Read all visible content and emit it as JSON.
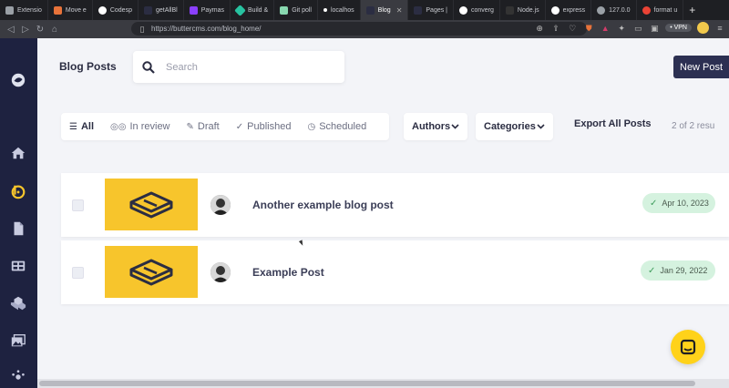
{
  "browser": {
    "tabs": [
      {
        "label": "Extensio",
        "color": "#9aa0a6"
      },
      {
        "label": "Move e",
        "color": "#e8733a"
      },
      {
        "label": "Codesp",
        "color": "#ffffff"
      },
      {
        "label": "getAllBl",
        "color": "#2b2d42"
      },
      {
        "label": "Paymas",
        "color": "#8a3ffc"
      },
      {
        "label": "Build &",
        "color": "#27c2a0"
      },
      {
        "label": "Git poll",
        "color": "#88d8b0"
      },
      {
        "label": "localhos",
        "color": "#ffffff"
      },
      {
        "label": "Blog",
        "color": "#2b2d42",
        "active": true,
        "close": "✕"
      },
      {
        "label": "Pages |",
        "color": "#2b2d42"
      },
      {
        "label": "converg",
        "color": "#ffffff"
      },
      {
        "label": "Node.js",
        "color": "#333333"
      },
      {
        "label": "express",
        "color": "#ffffff"
      },
      {
        "label": "127.0.0",
        "color": "#9aa0a6"
      },
      {
        "label": "format u",
        "color": "#ea4335"
      }
    ],
    "new_tab_symbol": "+",
    "url": "https://buttercms.com/blog_home/",
    "vpn_label": "• VPN"
  },
  "header": {
    "title": "Blog Posts",
    "search_placeholder": "Search",
    "new_post_label": "New Post"
  },
  "filters": {
    "tabs": [
      {
        "label": "All",
        "icon": "list-icon",
        "active": true
      },
      {
        "label": "In review",
        "icon": "glasses-icon"
      },
      {
        "label": "Draft",
        "icon": "pencil-icon"
      },
      {
        "label": "Published",
        "icon": "check-icon"
      },
      {
        "label": "Scheduled",
        "icon": "clock-icon"
      }
    ],
    "authors_label": "Authors",
    "categories_label": "Categories",
    "export_label": "Export All Posts",
    "count_text": "2 of 2 resu"
  },
  "posts": [
    {
      "title": "Another example blog post",
      "date": "Apr 10, 2023",
      "status": "published"
    },
    {
      "title": "Example Post",
      "date": "Jan 29, 2022",
      "status": "published"
    }
  ],
  "colors": {
    "sidebar": "#1e2240",
    "accent": "#2c3052",
    "thumb": "#f7c52c",
    "badge": "#d5f2df",
    "chat": "#ffd21a"
  }
}
